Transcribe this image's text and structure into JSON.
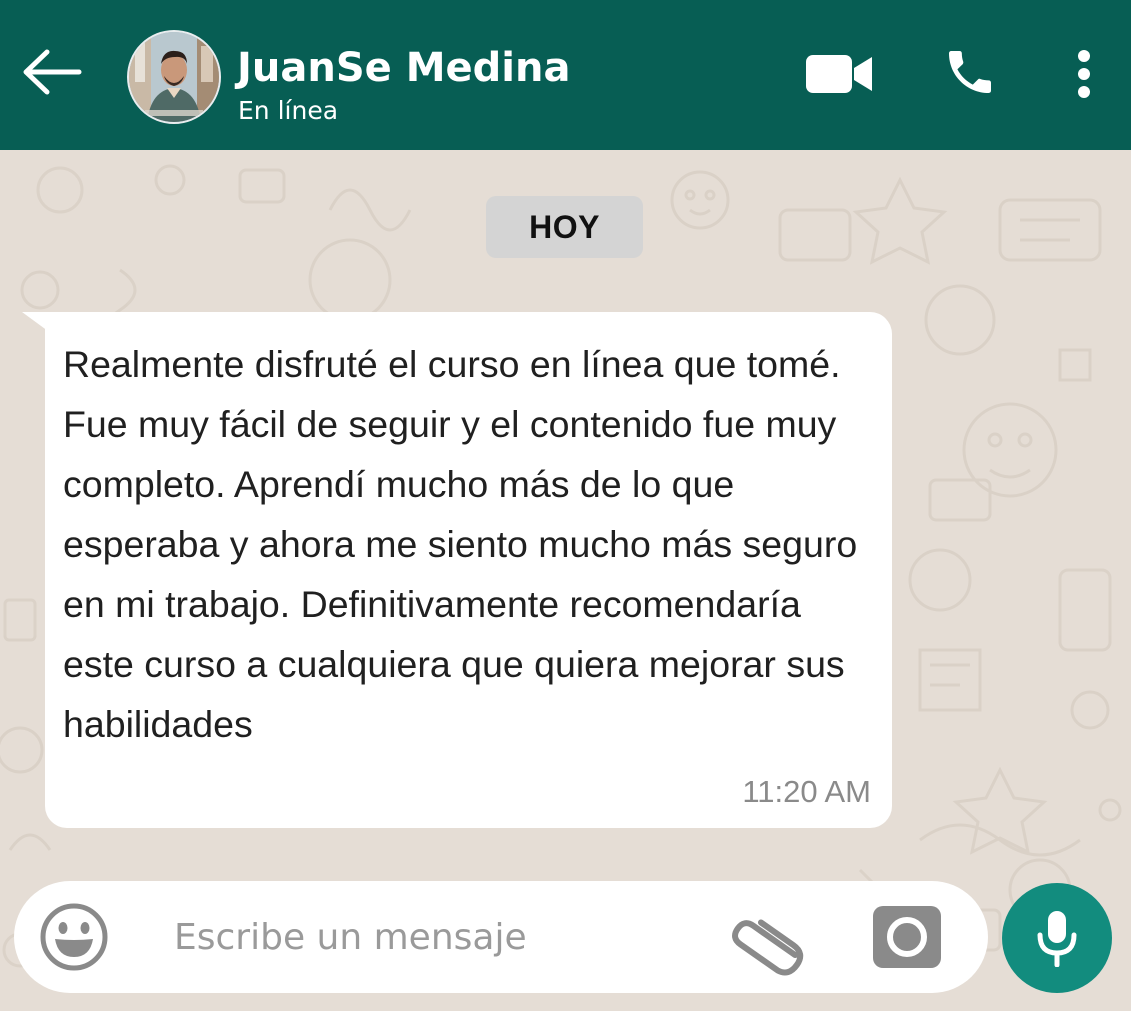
{
  "header": {
    "contact_name": "JuanSe Medina",
    "status": "En línea",
    "back_icon": "arrow-left-icon",
    "video_icon": "video-camera-icon",
    "call_icon": "phone-icon",
    "menu_icon": "more-vertical-icon"
  },
  "chat": {
    "date_separator": "HOY",
    "messages": [
      {
        "direction": "incoming",
        "text": "Realmente disfruté el curso en línea que tomé. Fue muy fácil de seguir y el contenido fue muy completo. Aprendí mucho más de lo que esperaba y ahora me siento mucho más seguro en mi trabajo. Definitivamente recomendaría este curso a cualquiera que quiera mejorar sus habilidades",
        "time": "11:20 AM"
      }
    ]
  },
  "composer": {
    "placeholder": "Escribe un mensaje",
    "value": "",
    "emoji_icon": "emoji-icon",
    "attach_icon": "paperclip-icon",
    "camera_icon": "camera-icon",
    "mic_icon": "microphone-icon"
  },
  "colors": {
    "header_bg": "#075e54",
    "chat_bg": "#e5ddd5",
    "bubble_bg": "#ffffff",
    "date_chip_bg": "#d4d4d4",
    "mic_button_bg": "#128c7e"
  }
}
